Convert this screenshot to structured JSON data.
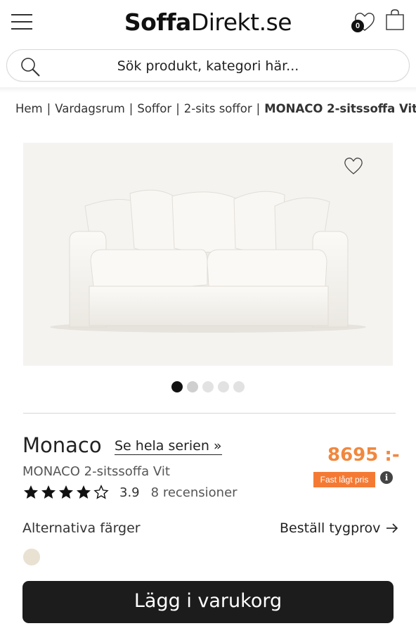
{
  "header": {
    "logo_bold": "Soffa",
    "logo_light": "Direkt.se",
    "wishlist_count": "0"
  },
  "search": {
    "placeholder": "Sök produkt, kategori här..."
  },
  "breadcrumb": {
    "items": [
      "Hem",
      "Vardagsrum",
      "Soffor",
      "2-sits soffor"
    ],
    "current": "MONACO 2-sitssoffa Vit",
    "separator": "|"
  },
  "gallery": {
    "image_count": 5,
    "active_index": 0
  },
  "product": {
    "name": "Monaco",
    "series_link": "Se hela serien »",
    "full_name": "MONACO 2-sitssoffa Vit",
    "price": "8695 :-",
    "price_badge": "Fast lågt pris",
    "info_symbol": "i",
    "rating": "3.9",
    "rating_stars": 4,
    "rating_max": 5,
    "reviews": "8 recensioner"
  },
  "options": {
    "alt_colors_label": "Alternativa färger",
    "fabric_sample_label": "Beställ tygprov",
    "swatch_color": "#e9e1d2"
  },
  "actions": {
    "add_to_cart": "Lägg i varukorg"
  },
  "colors": {
    "accent": "#f0883e",
    "badge": "#f47a34",
    "button": "#1c1c1c"
  }
}
